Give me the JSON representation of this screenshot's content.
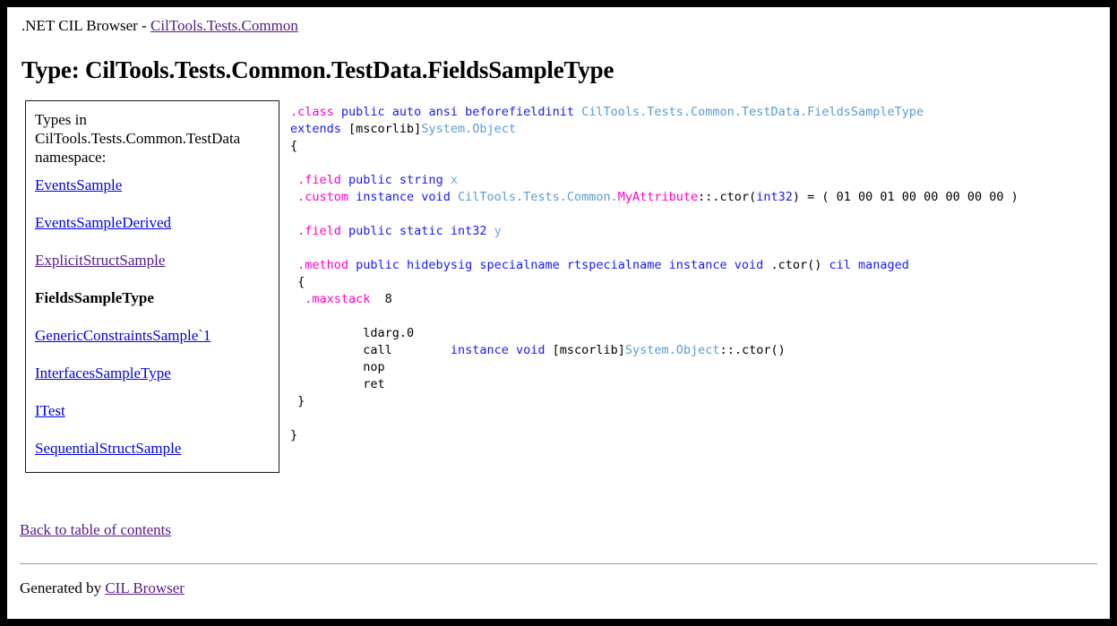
{
  "breadcrumb": {
    "prefix": ".NET CIL Browser - ",
    "link_label": "CilTools.Tests.Common"
  },
  "page_title": "Type: CilTools.Tests.Common.TestData.FieldsSampleType",
  "sidebar": {
    "heading": "Types in CilTools.Tests.Common.TestData namespace:",
    "items": [
      {
        "label": "EventsSample",
        "state": "unvisited",
        "current": false
      },
      {
        "label": "EventsSampleDerived",
        "state": "unvisited",
        "current": false
      },
      {
        "label": "ExplicitStructSample",
        "state": "visited",
        "current": false
      },
      {
        "label": "FieldsSampleType",
        "state": "current",
        "current": true
      },
      {
        "label": "GenericConstraintsSample`1",
        "state": "unvisited",
        "current": false
      },
      {
        "label": "InterfacesSampleType",
        "state": "unvisited",
        "current": false
      },
      {
        "label": "ITest",
        "state": "unvisited",
        "current": false
      },
      {
        "label": "SequentialStructSample",
        "state": "unvisited",
        "current": false
      }
    ]
  },
  "code": {
    "language": "CIL",
    "colors": {
      "directive": "#ff00c8",
      "keyword": "#1818ff",
      "type": "#5b9bd5",
      "identifier": "#6fa8dc",
      "plain": "#000000"
    },
    "lines": [
      [
        {
          "t": ".class ",
          "c": "dir"
        },
        {
          "t": "public auto ansi beforefieldinit ",
          "c": "kw"
        },
        {
          "t": "CilTools.Tests.Common.TestData.FieldsSampleType",
          "c": "type"
        }
      ],
      [
        {
          "t": "extends ",
          "c": "kw"
        },
        {
          "t": "[mscorlib]",
          "c": "plain"
        },
        {
          "t": "System.Object",
          "c": "type"
        }
      ],
      [
        {
          "t": "{",
          "c": "plain"
        }
      ],
      [
        {
          "t": "",
          "c": "plain"
        }
      ],
      [
        {
          "t": " .field ",
          "c": "dir"
        },
        {
          "t": "public string ",
          "c": "kw"
        },
        {
          "t": "x",
          "c": "id"
        }
      ],
      [
        {
          "t": " .custom ",
          "c": "dir"
        },
        {
          "t": "instance void ",
          "c": "kw"
        },
        {
          "t": "CilTools.Tests.Common.",
          "c": "type"
        },
        {
          "t": "MyAttribute",
          "c": "attr"
        },
        {
          "t": "::.ctor(",
          "c": "plain"
        },
        {
          "t": "int32",
          "c": "kw"
        },
        {
          "t": ") = ( 01 00 01 00 00 00 00 00 )",
          "c": "plain"
        }
      ],
      [
        {
          "t": "",
          "c": "plain"
        }
      ],
      [
        {
          "t": " .field ",
          "c": "dir"
        },
        {
          "t": "public static int32 ",
          "c": "kw"
        },
        {
          "t": "y",
          "c": "id"
        }
      ],
      [
        {
          "t": "",
          "c": "plain"
        }
      ],
      [
        {
          "t": " .method ",
          "c": "dir"
        },
        {
          "t": "public hidebysig specialname rtspecialname instance void ",
          "c": "kw"
        },
        {
          "t": ".ctor() ",
          "c": "plain"
        },
        {
          "t": "cil managed",
          "c": "kw"
        }
      ],
      [
        {
          "t": " {",
          "c": "plain"
        }
      ],
      [
        {
          "t": "  .maxstack",
          "c": "dir"
        },
        {
          "t": "  8",
          "c": "plain"
        }
      ],
      [
        {
          "t": "",
          "c": "plain"
        }
      ],
      [
        {
          "t": "          ldarg.0",
          "c": "plain"
        }
      ],
      [
        {
          "t": "          call        ",
          "c": "plain"
        },
        {
          "t": "instance void ",
          "c": "kw"
        },
        {
          "t": "[mscorlib]",
          "c": "plain"
        },
        {
          "t": "System.Object",
          "c": "type"
        },
        {
          "t": "::.ctor()",
          "c": "plain"
        }
      ],
      [
        {
          "t": "          nop",
          "c": "plain"
        }
      ],
      [
        {
          "t": "          ret",
          "c": "plain"
        }
      ],
      [
        {
          "t": " }",
          "c": "plain"
        }
      ],
      [
        {
          "t": "",
          "c": "plain"
        }
      ],
      [
        {
          "t": "}",
          "c": "plain"
        }
      ]
    ]
  },
  "back_link": "Back to table of contents",
  "footer": {
    "prefix": "Generated by ",
    "link_label": "CIL Browser"
  }
}
